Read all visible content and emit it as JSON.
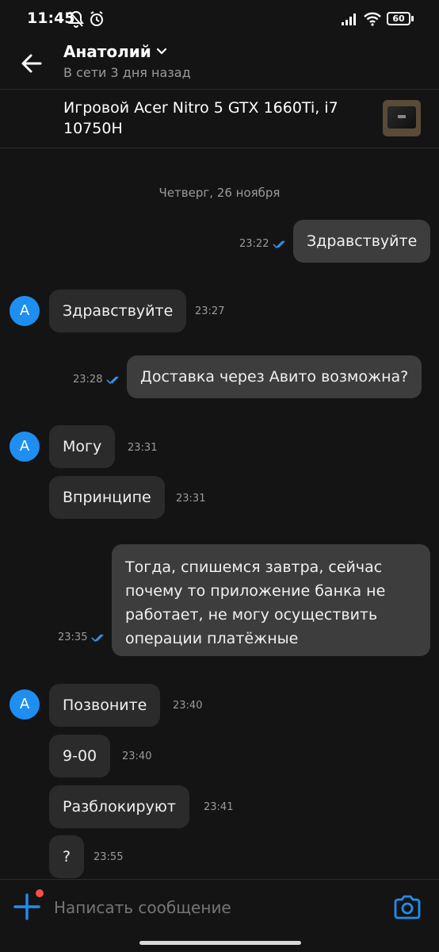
{
  "status_bar": {
    "time": "11:45",
    "battery": "60"
  },
  "header": {
    "name": "Анатолий",
    "status": "В сети 3 дня назад"
  },
  "item": {
    "title": "Игровой Acer Nitro 5 GTX 1660Ti, i7 10750H"
  },
  "chat": {
    "date": "Четверг, 26 ноября",
    "avatar_letter": "А",
    "messages": [
      {
        "text": "Здравствуйте",
        "time": "23:22"
      },
      {
        "text": "Здравствуйте",
        "time": "23:27"
      },
      {
        "text": "Доставка через Авито возможна?",
        "time": "23:28"
      },
      {
        "text": "Могу",
        "time": "23:31"
      },
      {
        "text": "Впринципе",
        "time": "23:31"
      },
      {
        "text": "Тогда, спишемся завтра, сейчас почему то приложение банка не работает, не могу осуществить операции платёжные",
        "time": "23:35"
      },
      {
        "text": "Позвоните",
        "time": "23:40"
      },
      {
        "text": "9-00",
        "time": "23:40"
      },
      {
        "text": "Разблокируют",
        "time": "23:41"
      },
      {
        "text": "?",
        "time": "23:55"
      }
    ]
  },
  "input": {
    "placeholder": "Написать сообщение"
  },
  "colors": {
    "accent": "#1f8ef1",
    "notification_dot": "#ff4b4b"
  }
}
